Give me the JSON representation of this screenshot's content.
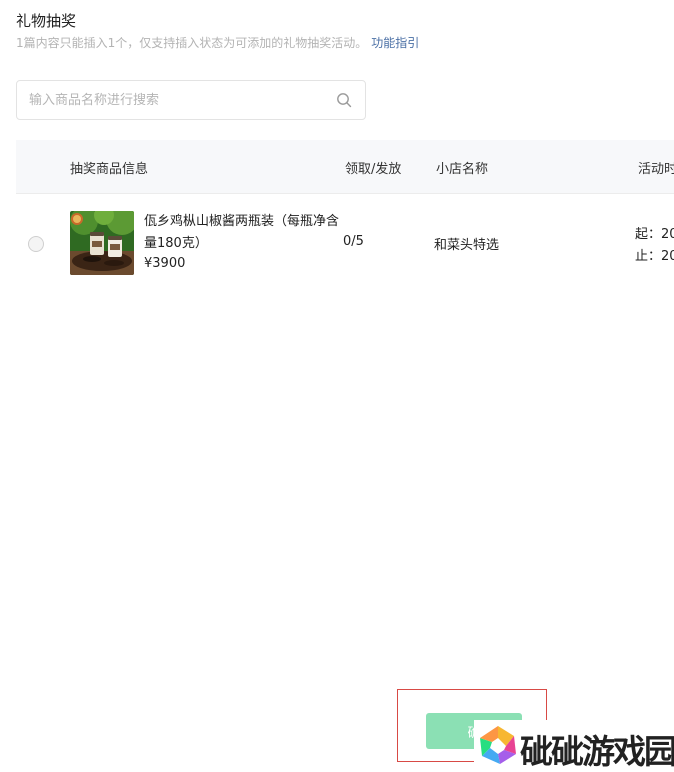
{
  "header": {
    "title": "礼物抽奖",
    "subtitle": "1篇内容只能插入1个，仅支持插入状态为可添加的礼物抽奖活动。",
    "guide_link": "功能指引"
  },
  "search": {
    "placeholder": "输入商品名称进行搜索",
    "value": ""
  },
  "table": {
    "columns": [
      "抽奖商品信息",
      "领取/发放",
      "小店名称",
      "活动时"
    ],
    "rows": [
      {
        "product_name": "佤乡鸡枞山椒酱两瓶装（每瓶净含量180克）",
        "price": "¥3900",
        "claimed": "0/5",
        "shop": "和菜头特选",
        "start": "起：20",
        "end": "止：20"
      }
    ]
  },
  "footer": {
    "confirm_label": "确"
  },
  "watermark": {
    "text": "䂣䂣游戏园"
  },
  "colors": {
    "accent_link": "#4a6fa5",
    "confirm_button": "#8be0b4",
    "highlight_frame": "#d84a45",
    "table_header_bg": "#f7f8fa"
  }
}
